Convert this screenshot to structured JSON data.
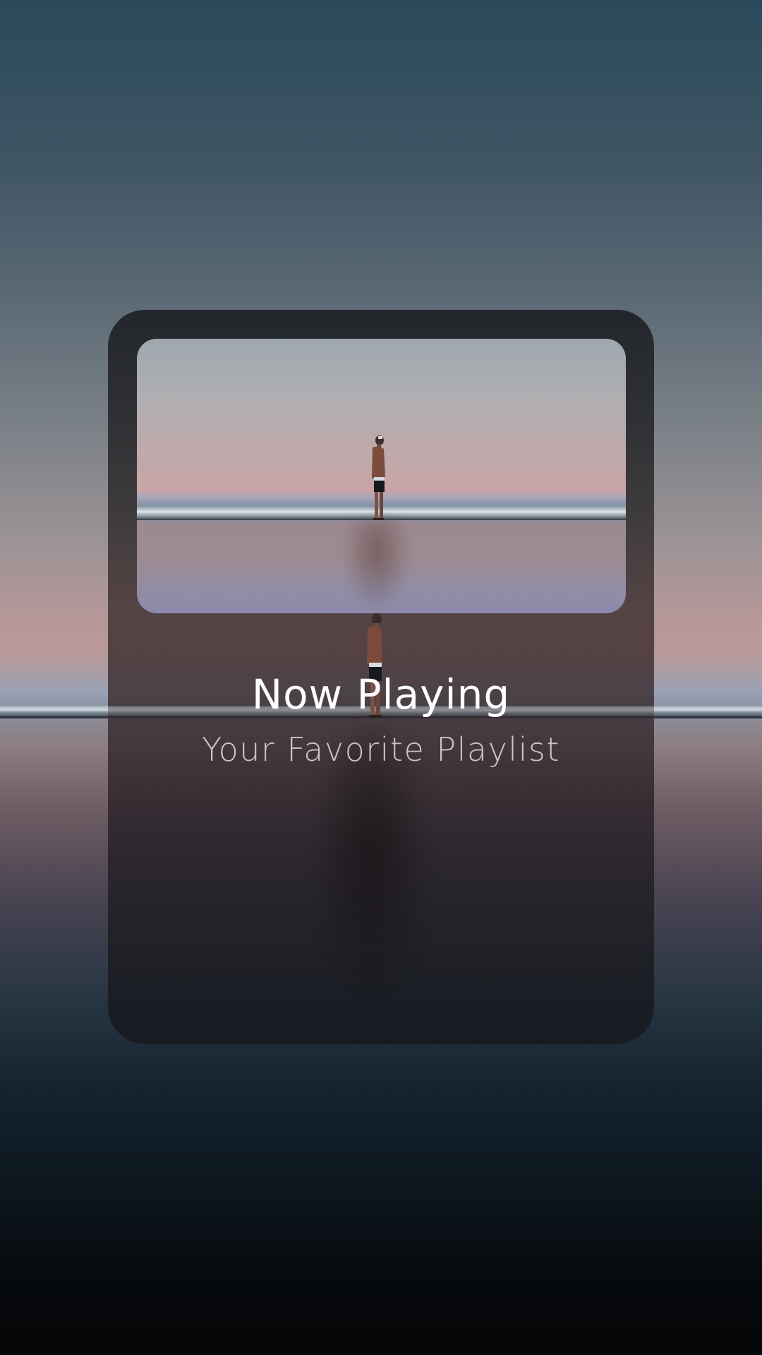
{
  "now_playing": {
    "title": "Now Playing",
    "subtitle": "Your Favorite Playlist"
  },
  "album_art": {
    "description_icon": "album-cover-image"
  },
  "colors": {
    "card_background": "#2a2a30",
    "title_text": "#ffffff",
    "subtitle_text": "#e1dee0"
  }
}
